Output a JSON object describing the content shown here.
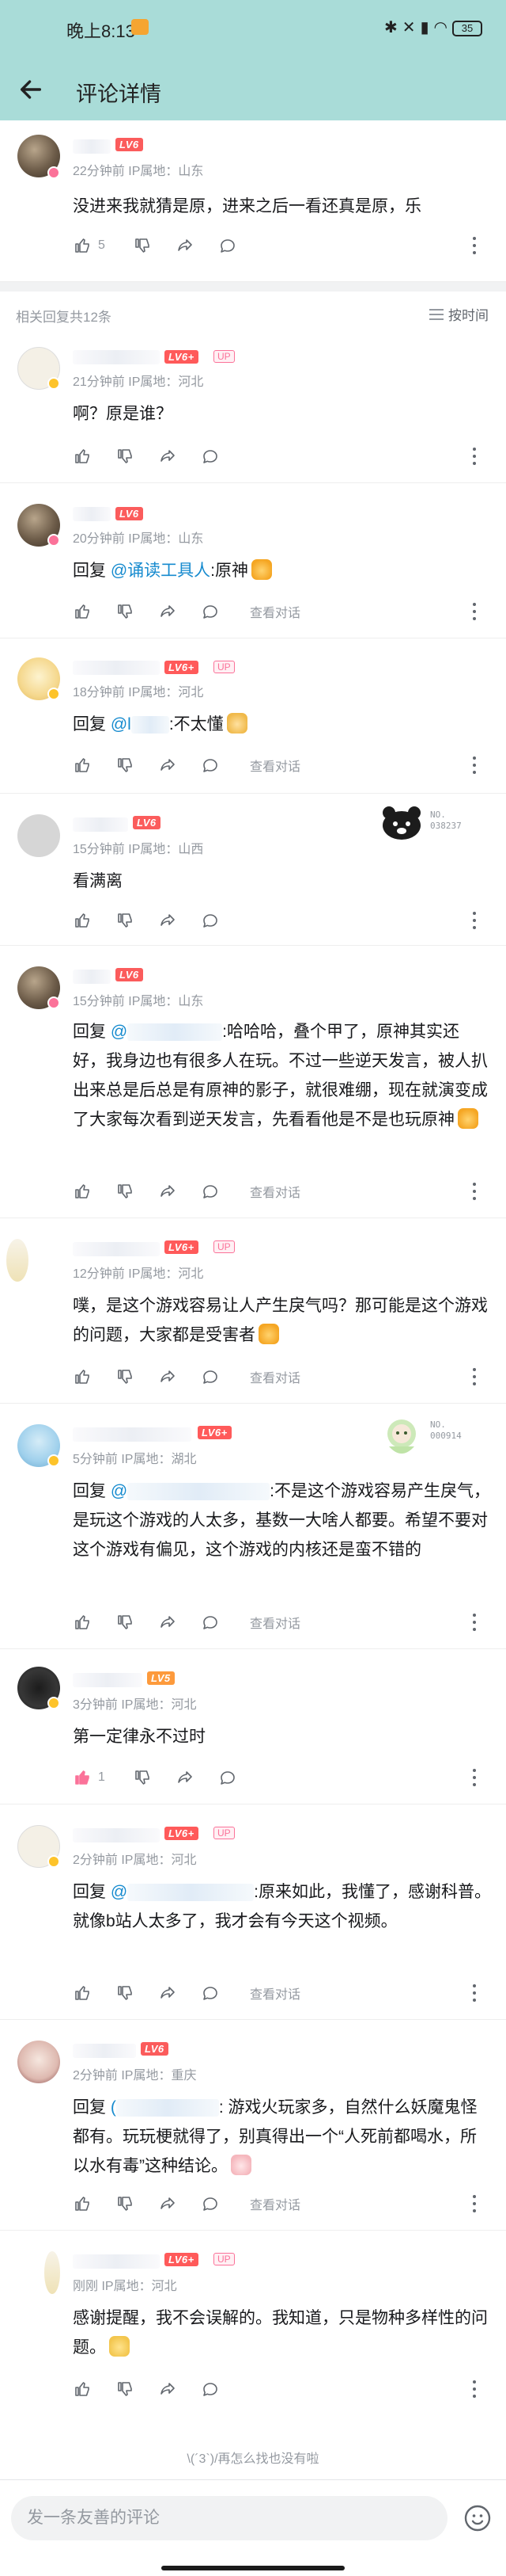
{
  "status_bar": {
    "time": "晚上8:13",
    "battery": "35"
  },
  "header": {
    "title": "评论详情"
  },
  "root_comment": {
    "level": "LV6",
    "meta": "22分钟前  IP属地：山东",
    "text": "没进来我就猜是原，进来之后一看还真是原，乐",
    "likes": "5"
  },
  "replies_header": {
    "count_text": "相关回复共12条",
    "sort_label": "按时间"
  },
  "view_conversation": "查看对话",
  "reply_prefix": "回复 ",
  "replies": [
    {
      "level": "LV6+",
      "up": "UP",
      "meta": "21分钟前  IP属地：河北",
      "text": "啊？原是谁？"
    },
    {
      "level": "LV6",
      "meta": "20分钟前  IP属地：山东",
      "mention": "@诵读工具人",
      "text": ":原神"
    },
    {
      "level": "LV6+",
      "up": "UP",
      "meta": "18分钟前  IP属地：河北",
      "mention_visible": "@l",
      "text": ":不太懂"
    },
    {
      "level": "LV6",
      "meta": "15分钟前  IP属地：山西",
      "text": "看满离",
      "decor_label": "NO.\n038237"
    },
    {
      "level": "LV6",
      "meta": "15分钟前  IP属地：山东",
      "mention_visible": "@",
      "text": ":哈哈哈，叠个甲了，原神其实还好，我身边也有很多人在玩。不过一些逆天发言，被人扒出来总是后总是有原神的影子，就很难绷，现在就演变成了大家每次看到逆天发言，先看看他是不是也玩原神"
    },
    {
      "level": "LV6+",
      "up": "UP",
      "meta": "12分钟前  IP属地：河北",
      "text": "噗，是这个游戏容易让人产生戾气吗？那可能是这个游戏的问题，大家都是受害者"
    },
    {
      "level": "LV6+",
      "meta": "5分钟前  IP属地：湖北",
      "mention_visible": "@",
      "text": ":不是这个游戏容易产生戾气，是玩这个游戏的人太多，基数一大啥人都要。希望不要对这个游戏有偏见，这个游戏的内核还是蛮不错的",
      "decor_label": "NO.\n000914"
    },
    {
      "level": "LV5",
      "meta": "3分钟前  IP属地：河北",
      "text": "第一定律永不过时",
      "likes": "1"
    },
    {
      "level": "LV6+",
      "up": "UP",
      "meta": "2分钟前  IP属地：河北",
      "mention_visible": "@",
      "text": ":原来如此，我懂了，感谢科普。就像b站人太多了，我才会有今天这个视频。"
    },
    {
      "level": "LV6",
      "meta": "2分钟前  IP属地：重庆",
      "mention_visible": "(",
      "text": ": 游戏火玩家多，自然什么妖魔鬼怪都有。玩玩梗就得了，别真得出一个“人死前都喝水，所以水有毒”这种结论。"
    },
    {
      "level": "LV6+",
      "up": "UP",
      "meta": "刚刚  IP属地：河北",
      "text": "感谢提醒，我不会误解的。我知道，只是物种多样性的问题。"
    }
  ],
  "end_note": "\\(´3`)/再怎么找也没有啦",
  "input": {
    "placeholder": "发一条友善的评论"
  },
  "icons": [
    "back-arrow-icon",
    "like-icon",
    "dislike-icon",
    "share-icon",
    "reply-icon",
    "more-icon",
    "sort-icon",
    "emoji-icon"
  ],
  "colors": {
    "header_bg": "#a9dcd8",
    "level_badge": "#fb5c5c",
    "up_tag": "#fb7299",
    "mention": "#178bcf",
    "meta": "#9499a0"
  }
}
